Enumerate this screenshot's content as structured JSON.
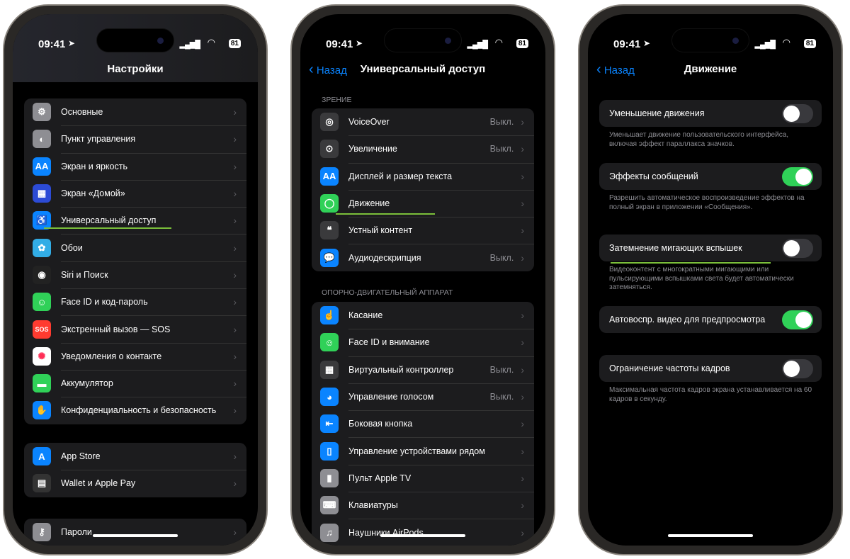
{
  "status": {
    "time": "09:41",
    "battery": "81"
  },
  "phone1": {
    "title": "Настройки",
    "group1": [
      {
        "label": "Основные",
        "icon": "gear-icon",
        "color": "#8e8e93"
      },
      {
        "label": "Пункт управления",
        "icon": "toggles-icon",
        "color": "#8e8e93"
      },
      {
        "label": "Экран и яркость",
        "icon": "text-size-icon",
        "color": "#0a84ff"
      },
      {
        "label": "Экран «Домой»",
        "icon": "home-grid-icon",
        "color": "#2c4bd6"
      },
      {
        "label": "Универсальный доступ",
        "icon": "accessibility-icon",
        "color": "#0a84ff"
      },
      {
        "label": "Обои",
        "icon": "wallpaper-icon",
        "color": "#32ade6"
      },
      {
        "label": "Siri и Поиск",
        "icon": "siri-icon",
        "color": "#222"
      },
      {
        "label": "Face ID и код-пароль",
        "icon": "faceid-icon",
        "color": "#30d158"
      },
      {
        "label": "Экстренный вызов — SOS",
        "icon": "sos-icon",
        "color": "#ff3b30"
      },
      {
        "label": "Уведомления о контакте",
        "icon": "exposure-icon",
        "color": "#fff"
      },
      {
        "label": "Аккумулятор",
        "icon": "battery-icon",
        "color": "#30d158"
      },
      {
        "label": "Конфиденциальность и безопасность",
        "icon": "hand-icon",
        "color": "#0a84ff"
      }
    ],
    "group2": [
      {
        "label": "App Store",
        "icon": "appstore-icon",
        "color": "#0a84ff"
      },
      {
        "label": "Wallet и Apple Pay",
        "icon": "wallet-icon",
        "color": "#333"
      }
    ],
    "group3": [
      {
        "label": "Пароли",
        "icon": "key-icon",
        "color": "#8e8e93"
      }
    ]
  },
  "phone2": {
    "back": "Назад",
    "title": "Универсальный доступ",
    "section1": "ЗРЕНИЕ",
    "group1": [
      {
        "label": "VoiceOver",
        "value": "Выкл.",
        "icon": "voiceover-icon",
        "color": "#3a3a3c"
      },
      {
        "label": "Увеличение",
        "value": "Выкл.",
        "icon": "zoom-icon",
        "color": "#3a3a3c"
      },
      {
        "label": "Дисплей и размер текста",
        "value": "",
        "icon": "text-size-icon",
        "color": "#0a84ff"
      },
      {
        "label": "Движение",
        "value": "",
        "icon": "motion-icon",
        "color": "#30d158"
      },
      {
        "label": "Устный контент",
        "value": "",
        "icon": "speech-icon",
        "color": "#3a3a3c"
      },
      {
        "label": "Аудиодескрипция",
        "value": "Выкл.",
        "icon": "audio-description-icon",
        "color": "#0a84ff"
      }
    ],
    "section2": "ОПОРНО-ДВИГАТЕЛЬНЫЙ АППАРАТ",
    "group2": [
      {
        "label": "Касание",
        "value": "",
        "icon": "touch-icon",
        "color": "#0a84ff"
      },
      {
        "label": "Face ID и внимание",
        "value": "",
        "icon": "faceid-icon",
        "color": "#30d158"
      },
      {
        "label": "Виртуальный контроллер",
        "value": "Выкл.",
        "icon": "switch-control-icon",
        "color": "#3a3a3c"
      },
      {
        "label": "Управление голосом",
        "value": "Выкл.",
        "icon": "voice-control-icon",
        "color": "#0a84ff"
      },
      {
        "label": "Боковая кнопка",
        "value": "",
        "icon": "side-button-icon",
        "color": "#0a84ff"
      },
      {
        "label": "Управление устройствами рядом",
        "value": "",
        "icon": "nearby-devices-icon",
        "color": "#0a84ff"
      },
      {
        "label": "Пульт Apple TV",
        "value": "",
        "icon": "remote-icon",
        "color": "#8e8e93"
      },
      {
        "label": "Клавиатуры",
        "value": "",
        "icon": "keyboard-icon",
        "color": "#8e8e93"
      },
      {
        "label": "Наушники AirPods",
        "value": "",
        "icon": "airpods-icon",
        "color": "#8e8e93"
      }
    ]
  },
  "phone3": {
    "back": "Назад",
    "title": "Движение",
    "items": [
      {
        "label": "Уменьшение движения",
        "on": false,
        "desc": "Уменьшает движение пользовательского интерфейса, включая эффект параллакса значков."
      },
      {
        "label": "Эффекты сообщений",
        "on": true,
        "desc": "Разрешить автоматическое воспроизведение эффектов на полный экран в приложении «Сообщения»."
      },
      {
        "label": "Затемнение мигающих вспышек",
        "on": false,
        "desc": "Видеоконтент с многократными мигающими или пульсирующими вспышками света будет автоматически затемняться."
      },
      {
        "label": "Автовоспр. видео для предпросмотра",
        "on": true,
        "desc": ""
      },
      {
        "label": "Ограничение частоты кадров",
        "on": false,
        "desc": "Максимальная частота кадров экрана устанавливается на 60 кадров в секунду."
      }
    ]
  },
  "colors": {
    "accent": "#0a84ff",
    "toggle_on": "#30d158",
    "highlight": "#7bbf3a"
  }
}
